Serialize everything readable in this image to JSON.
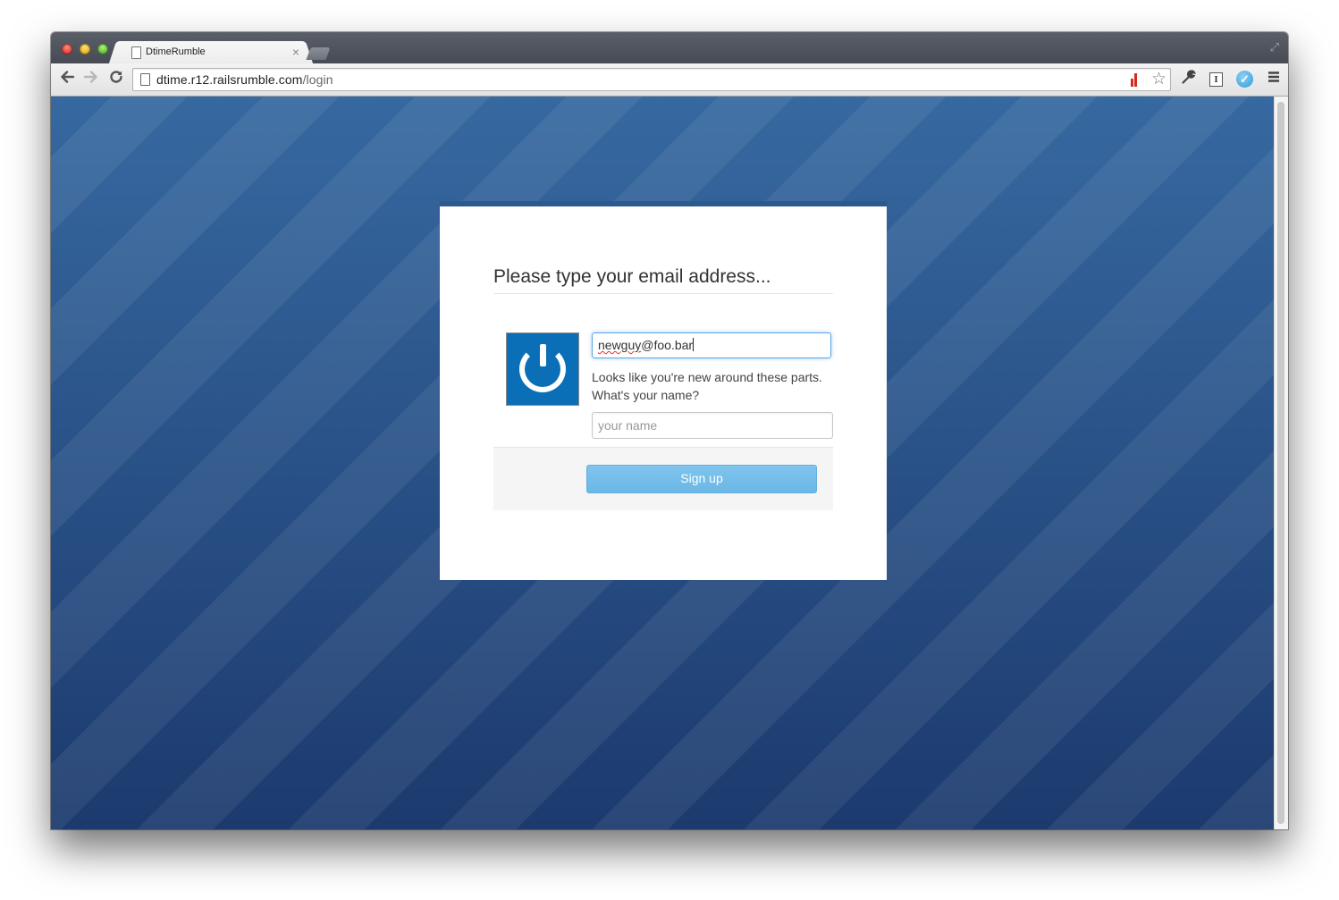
{
  "browser": {
    "tab_title": "DtimeRumble",
    "tab_close": "×",
    "url_host": "dtime.r12.railsrumble.com",
    "url_path": "/login",
    "icons": {
      "back": "arrow-left-icon",
      "forward": "arrow-right-icon",
      "reload": "reload-icon",
      "page": "page-icon",
      "bars": "bar-chart-icon",
      "star": "star-icon",
      "wrench": "wrench-icon",
      "instapaper": "instapaper-icon",
      "extension": "extension-icon",
      "menu": "menu-icon"
    },
    "ibox_letter": "I",
    "ext_letter": "✓"
  },
  "login": {
    "title": "Please type your email address...",
    "email_value_misspelled": "newguy",
    "email_value_rest": "@foo.bar",
    "hint_line1": "Looks like you're new around these parts.",
    "hint_line2": "What's your name?",
    "name_placeholder": "your name",
    "signup_label": "Sign up"
  },
  "colors": {
    "background_top": "#3669a0",
    "background_bottom": "#1c3a6e",
    "button": "#74bdea",
    "logo": "#0a6fb7"
  }
}
